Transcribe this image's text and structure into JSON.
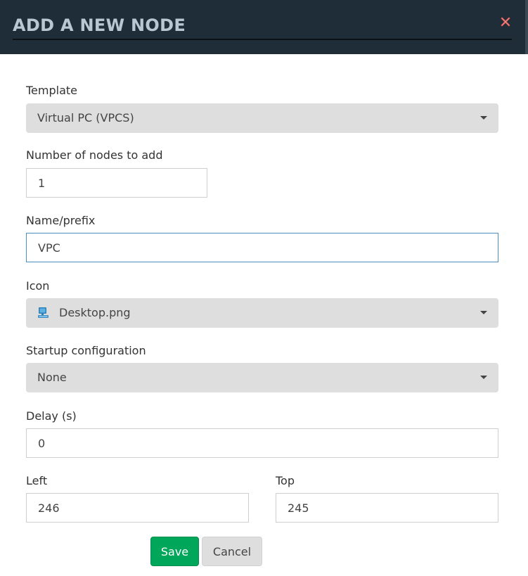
{
  "dialog": {
    "title": "ADD A NEW NODE",
    "close_icon": "close-icon"
  },
  "form": {
    "template": {
      "label": "Template",
      "value": "Virtual PC (VPCS)"
    },
    "nodes_count": {
      "label": "Number of nodes to add",
      "value": "1"
    },
    "name_prefix": {
      "label": "Name/prefix",
      "value": "VPC"
    },
    "icon": {
      "label": "Icon",
      "value": "Desktop.png",
      "icon": "desktop-icon"
    },
    "startup_config": {
      "label": "Startup configuration",
      "value": "None"
    },
    "delay": {
      "label": "Delay (s)",
      "value": "0"
    },
    "left": {
      "label": "Left",
      "value": "246"
    },
    "top": {
      "label": "Top",
      "value": "245"
    }
  },
  "buttons": {
    "save_label": "Save",
    "cancel_label": "Cancel"
  },
  "colors": {
    "header_bg": "#1f2d38",
    "title_text": "#b9c7d2",
    "save_bg": "#00a65a",
    "select_bg": "#dedede",
    "focus_border": "#4e8fbf",
    "close_icon": "#d9534f"
  }
}
